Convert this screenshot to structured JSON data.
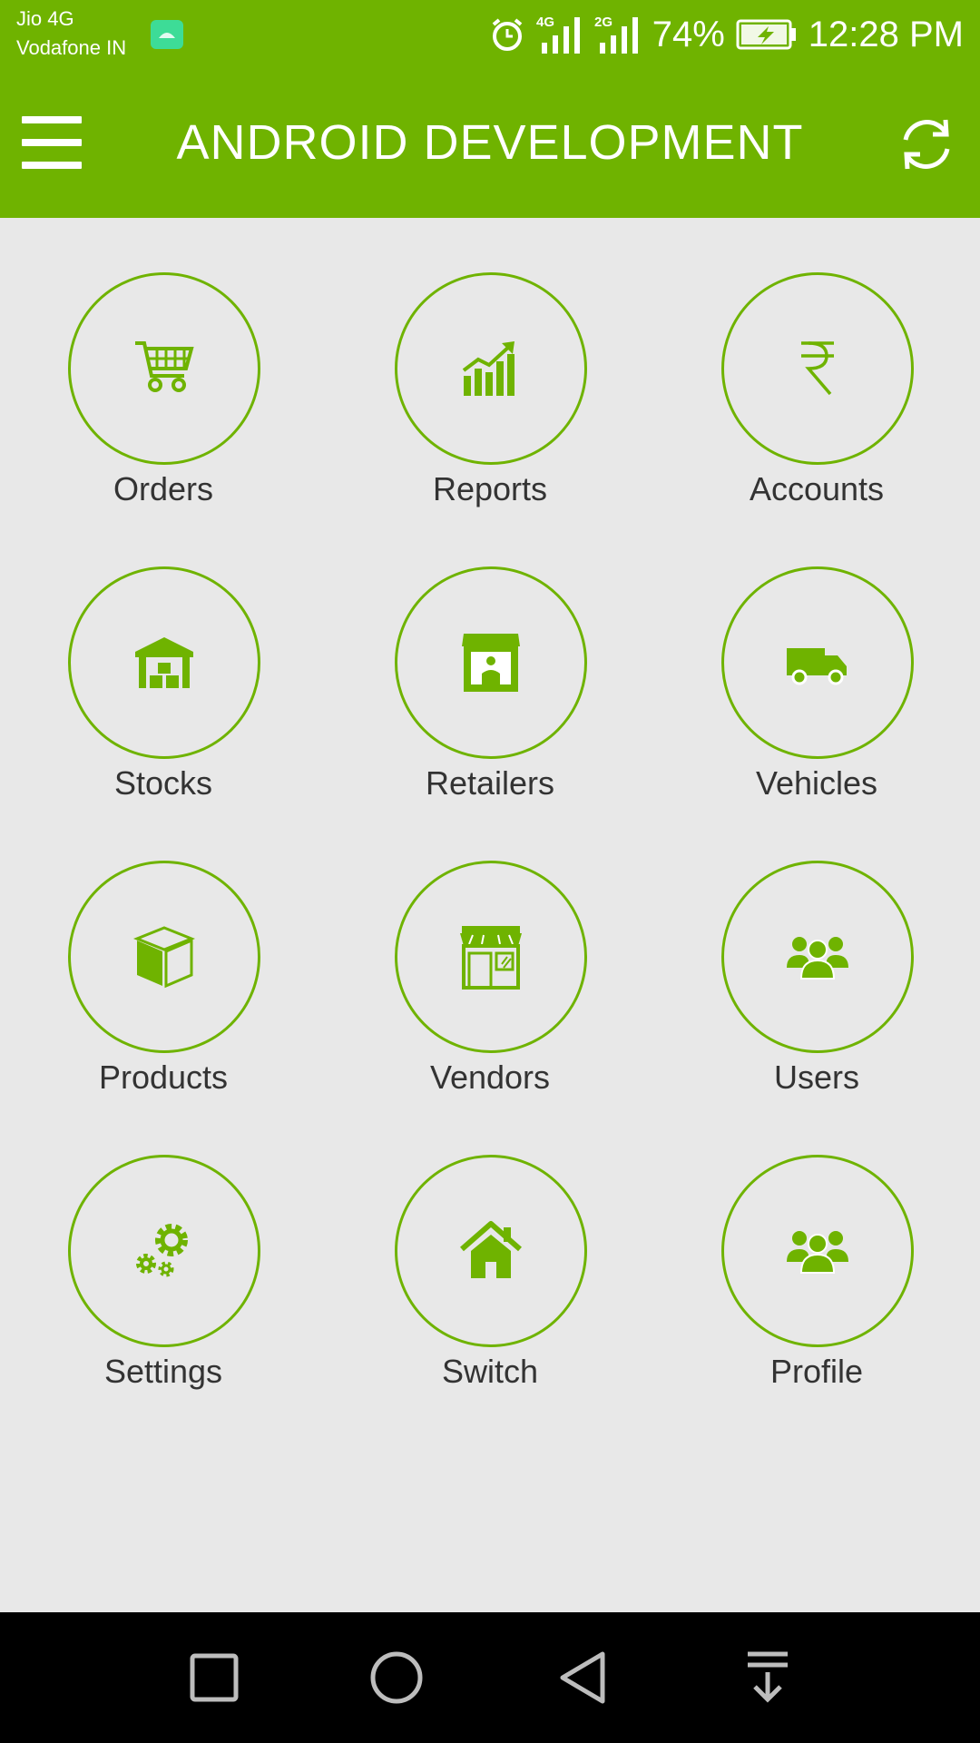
{
  "status_bar": {
    "carrier1": "Jio 4G",
    "carrier2": "Vodafone IN",
    "net1": "4G",
    "net2": "2G",
    "battery": "74%",
    "time": "12:28 PM"
  },
  "app_bar": {
    "title": "ANDROID DEVELOPMENT"
  },
  "accent_color": "#6fb300",
  "tiles": [
    {
      "label": "Orders",
      "icon": "cart-icon"
    },
    {
      "label": "Reports",
      "icon": "chart-icon"
    },
    {
      "label": "Accounts",
      "icon": "rupee-icon"
    },
    {
      "label": "Stocks",
      "icon": "warehouse-icon"
    },
    {
      "label": "Retailers",
      "icon": "retailer-shop-icon"
    },
    {
      "label": "Vehicles",
      "icon": "truck-icon"
    },
    {
      "label": "Products",
      "icon": "box-icon"
    },
    {
      "label": "Vendors",
      "icon": "store-icon"
    },
    {
      "label": "Users",
      "icon": "users-icon"
    },
    {
      "label": "Settings",
      "icon": "gears-icon"
    },
    {
      "label": "Switch",
      "icon": "home-icon"
    },
    {
      "label": "Profile",
      "icon": "users-icon"
    }
  ]
}
